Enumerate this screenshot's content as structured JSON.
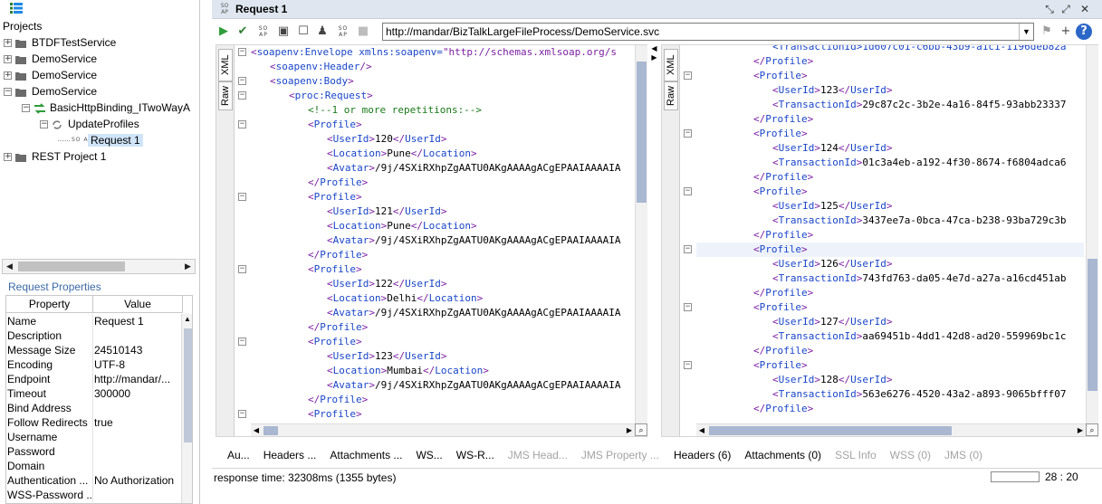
{
  "projects": {
    "label": "Projects",
    "tree": [
      {
        "expander": "+",
        "label": "BTDFTestService"
      },
      {
        "expander": "+",
        "label": "DemoService"
      },
      {
        "expander": "+",
        "label": "DemoService"
      },
      {
        "expander": "−",
        "label": "DemoService"
      },
      {
        "expander": "−",
        "label": "BasicHttpBinding_ITwoWayA"
      },
      {
        "expander": "−",
        "label": "UpdateProfiles"
      },
      {
        "expander": "",
        "label": "Request 1"
      },
      {
        "expander": "+",
        "label": "REST Project 1"
      }
    ]
  },
  "props": {
    "header": "Request Properties",
    "col_property": "Property",
    "col_value": "Value",
    "rows": [
      {
        "key": "Name",
        "value": "Request 1"
      },
      {
        "key": "Description",
        "value": ""
      },
      {
        "key": "Message Size",
        "value": "24510143"
      },
      {
        "key": "Encoding",
        "value": "UTF-8"
      },
      {
        "key": "Endpoint",
        "value": "http://mandar/..."
      },
      {
        "key": "Timeout",
        "value": "300000"
      },
      {
        "key": "Bind Address",
        "value": ""
      },
      {
        "key": "Follow Redirects",
        "value": "true"
      },
      {
        "key": "Username",
        "value": ""
      },
      {
        "key": "Password",
        "value": ""
      },
      {
        "key": "Domain",
        "value": ""
      },
      {
        "key": "Authentication ...",
        "value": "No Authorization"
      },
      {
        "key": "WSS-Password ...",
        "value": ""
      }
    ]
  },
  "editor": {
    "soap_badge": "SO AP",
    "title": "Request 1",
    "endpoint": "http://mandar/BizTalkLargeFileProcess/DemoService.svc",
    "tab_xml": "XML",
    "tab_raw": "Raw",
    "fold_minus": "−",
    "close_glyph": "✕",
    "req_tabs": [
      "Au...",
      "Headers ...",
      "Attachments ...",
      "WS...",
      "WS-R..."
    ],
    "req_tabs_disabled": [
      "JMS Head...",
      "JMS Property ..."
    ],
    "resp_tabs": [
      "Headers (6)",
      "Attachments (0)"
    ],
    "resp_tabs_disabled": [
      "SSL Info",
      "WSS (0)",
      "JMS (0)"
    ],
    "response_time": "response time: 32308ms (1355 bytes)",
    "cursor_pos": "28 : 20"
  },
  "request_xml": {
    "envelope_attr": " xmlns:soapenv=",
    "envelope_attr_val": "\"http://schemas.xmlsoap.org/s",
    "comment": "<!--1 or more repetitions:-->",
    "avatar_value": "/9j/4SXiRXhpZgAATU0AKgAAAAgACgEPAAIAAAAIA",
    "profiles": [
      {
        "user_id": "120",
        "location": "Pune"
      },
      {
        "user_id": "121",
        "location": "Pune"
      },
      {
        "user_id": "122",
        "location": "Delhi"
      },
      {
        "user_id": "123",
        "location": "Mumbai"
      }
    ]
  },
  "response_xml": {
    "top_partial": "<TransactionId>1d607c01-c6bb-43b9-a1c1-1196deb82a",
    "profiles": [
      {
        "user_id": "123",
        "transaction_id": "29c87c2c-3b2e-4a16-84f5-93abb23337"
      },
      {
        "user_id": "124",
        "transaction_id": "01c3a4eb-a192-4f30-8674-f6804adca6"
      },
      {
        "user_id": "125",
        "transaction_id": "3437ee7a-0bca-47ca-b238-93ba729c3b"
      },
      {
        "user_id": "126",
        "transaction_id": "743fd763-da05-4e7d-a27a-a16cd451ab"
      },
      {
        "user_id": "127",
        "transaction_id": "aa69451b-4dd1-42d8-ad20-559969bc1c"
      },
      {
        "user_id": "128",
        "transaction_id": "563e6276-4520-43a2-a893-9065bfff07"
      }
    ]
  },
  "colors": {
    "tag": "#7b1fa2",
    "tag_name": "#1a46c8",
    "comment": "#1a7a1a",
    "scroll_thumb": "#a9b7d0",
    "title_bar": "#dfe6ef"
  }
}
